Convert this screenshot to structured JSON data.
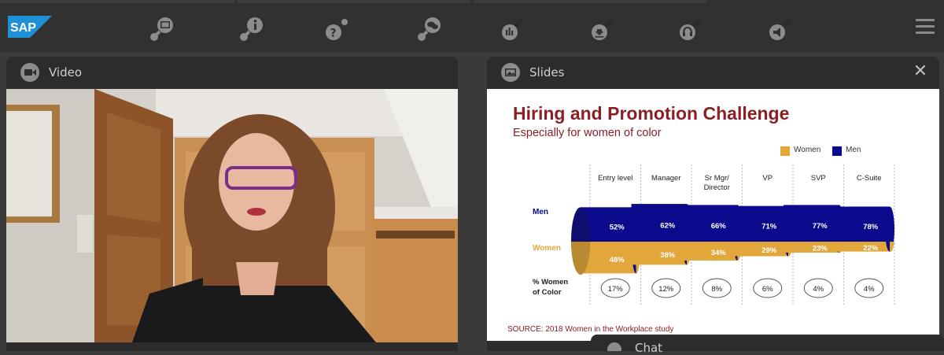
{
  "brand": {
    "logo_text": "SAP"
  },
  "toolbar": {
    "tools": [
      {
        "icon": "image-icon"
      },
      {
        "icon": "info-icon"
      },
      {
        "icon": "question-icon"
      },
      {
        "icon": "chat-bubbles-icon"
      },
      {
        "icon": "poll-chart-icon"
      },
      {
        "icon": "download-icon"
      },
      {
        "icon": "headset-icon"
      },
      {
        "icon": "megaphone-icon"
      }
    ],
    "menu_icon": "hamburger-menu-icon"
  },
  "video_panel": {
    "title": "Video",
    "icon": "camera-icon"
  },
  "slides_panel": {
    "title": "Slides",
    "icon": "picture-icon",
    "close": "✕"
  },
  "chat_panel": {
    "title": "Chat"
  },
  "slide": {
    "title": "Hiring and Promotion Challenge",
    "subtitle": "Especially for women of color",
    "source": "SOURCE: 2018 Women in the Workplace study",
    "legend": {
      "women": "Women",
      "men": "Men"
    },
    "row_labels": {
      "men": "Men",
      "women": "Women",
      "woc_line1": "% Women",
      "woc_line2": "of Color"
    },
    "colors": {
      "men": "#0b0a8c",
      "women": "#e1a73a",
      "title": "#8a1f26"
    }
  },
  "chart_data": {
    "type": "bar",
    "categories": [
      "Entry level",
      "Manager",
      "Sr Mgr/ Director",
      "VP",
      "SVP",
      "C-Suite"
    ],
    "category_lines": [
      [
        "Entry level"
      ],
      [
        "Manager"
      ],
      [
        "Sr Mgr/",
        "Director"
      ],
      [
        "VP"
      ],
      [
        "SVP"
      ],
      [
        "C-Suite"
      ]
    ],
    "series": [
      {
        "name": "Men",
        "values": [
          52,
          62,
          66,
          71,
          77,
          78
        ],
        "labels": [
          "52%",
          "62%",
          "66%",
          "71%",
          "77%",
          "78%"
        ]
      },
      {
        "name": "Women",
        "values": [
          48,
          38,
          34,
          29,
          23,
          22
        ],
        "labels": [
          "48%",
          "38%",
          "34%",
          "29%",
          "23%",
          "22%"
        ]
      }
    ],
    "women_of_color": {
      "values": [
        17,
        12,
        8,
        6,
        4,
        4
      ],
      "labels": [
        "17%",
        "12%",
        "8%",
        "6%",
        "4%",
        "4%"
      ]
    },
    "title": "Hiring and Promotion Challenge",
    "legend": "top-right"
  }
}
